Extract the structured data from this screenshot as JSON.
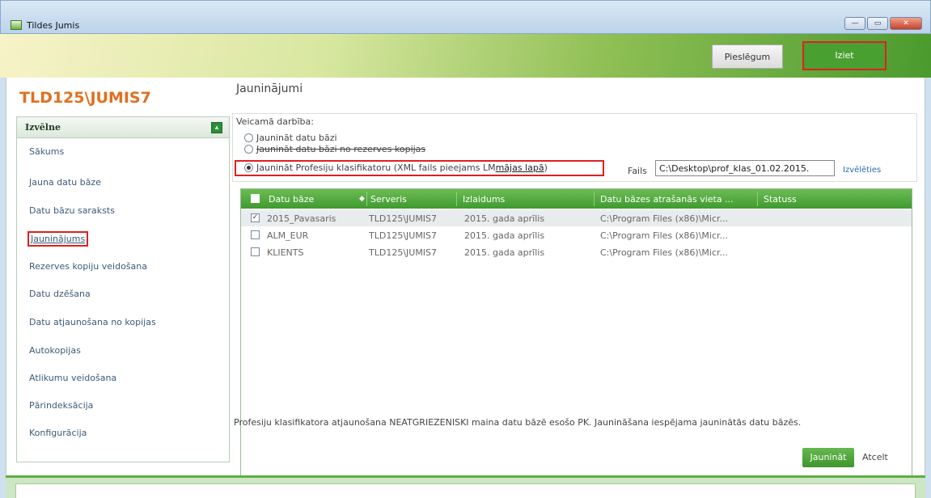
{
  "window": {
    "title": "Tildes Jumis",
    "controls": {
      "minimize": "—",
      "maximize": "▭",
      "close": "✕"
    }
  },
  "header": {
    "connect_label": "Pieslēgum",
    "exit_label": "Iziet"
  },
  "server": {
    "name": "TLD125\\JUMIS7"
  },
  "menu": {
    "title": "Izvēlne",
    "collapse_glyph": "▴",
    "items": [
      {
        "label": "Sākums"
      },
      {
        "label": "Jauna datu bāze"
      },
      {
        "label": "Datu bāzu saraksts"
      },
      {
        "label": "Jauninājums",
        "active": true
      },
      {
        "label": "Rezerves kopiju veidošana"
      },
      {
        "label": "Datu dzēšana"
      },
      {
        "label": "Datu atjaunošana no kopijas"
      },
      {
        "label": "Autokopijas"
      },
      {
        "label": "Atlikumu veidošana"
      },
      {
        "label": "Pārindeksācija"
      },
      {
        "label": "Konfigurācija"
      }
    ]
  },
  "content": {
    "title": "Jauninājumi",
    "action_label": "Veicamā darbība:",
    "options": [
      {
        "label": "Jaunināt datu bāzi",
        "checked": false
      },
      {
        "label": "Jaunināt datu bāzi no rezerves kopijas",
        "checked": false
      },
      {
        "label_pre": "Jaunināt Profesiju klasifikatoru (XML fails pieejams LM ",
        "link": "mājas lapā",
        "label_post": ")",
        "checked": true
      }
    ],
    "file_label": "Fails",
    "file_value": "C:\\Desktop\\prof_klas_01.02.2015.",
    "choose_label": "Izvēlēties"
  },
  "table": {
    "columns": [
      "Datu bāze",
      "Serveris",
      "Izlaidums",
      "Datu bāzes atrašanās vieta ...",
      "Statuss"
    ],
    "rows": [
      {
        "checked": true,
        "database": "2015_Pavasaris",
        "server": "TLD125\\JUMIS7",
        "release": "2015. gada aprīlis",
        "location": "C:\\Program Files (x86)\\Micr...",
        "status": ""
      },
      {
        "checked": false,
        "database": "ALM_EUR",
        "server": "TLD125\\JUMIS7",
        "release": "2015. gada aprīlis",
        "location": "C:\\Program Files (x86)\\Micr...",
        "status": ""
      },
      {
        "checked": false,
        "database": "KLIENTS",
        "server": "TLD125\\JUMIS7",
        "release": "2015. gada aprīlis",
        "location": "C:\\Program Files (x86)\\Micr...",
        "status": ""
      }
    ]
  },
  "info_text": "Profesiju klasifikatora atjaunošana NEATGRIEZENISKI maina datu bāzē esošo PK. Jaunināšana iespējama jauninātās datu bāzēs.",
  "buttons": {
    "update": "Jaunināt",
    "cancel": "Atcelt"
  },
  "colors": {
    "accent": "#e07020",
    "green": "#48a030",
    "highlight": "#e02020"
  }
}
